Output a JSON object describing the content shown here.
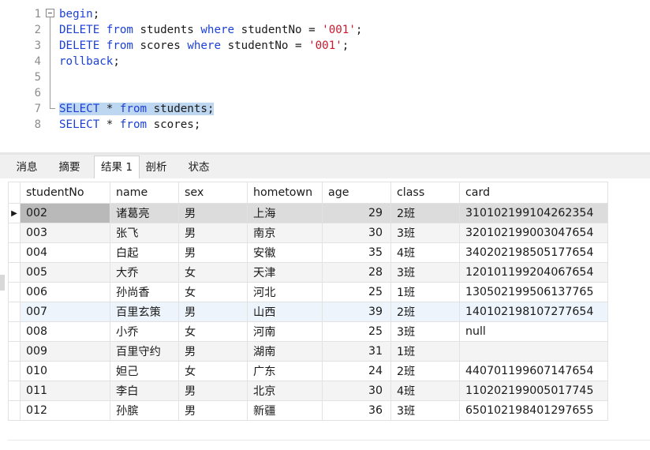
{
  "editor": {
    "line_numbers": [
      "1",
      "2",
      "3",
      "4",
      "5",
      "6",
      "7",
      "8"
    ],
    "lines": [
      [
        {
          "t": "begin",
          "c": "kw"
        },
        {
          "t": ";",
          "c": ""
        }
      ],
      [
        {
          "t": "DELETE",
          "c": "kw"
        },
        {
          "t": " ",
          "c": ""
        },
        {
          "t": "from",
          "c": "kw"
        },
        {
          "t": " students ",
          "c": ""
        },
        {
          "t": "where",
          "c": "kw"
        },
        {
          "t": " studentNo = ",
          "c": ""
        },
        {
          "t": "'001'",
          "c": "str"
        },
        {
          "t": ";",
          "c": ""
        }
      ],
      [
        {
          "t": "DELETE",
          "c": "kw"
        },
        {
          "t": " ",
          "c": ""
        },
        {
          "t": "from",
          "c": "kw"
        },
        {
          "t": " scores ",
          "c": ""
        },
        {
          "t": "where",
          "c": "kw"
        },
        {
          "t": " studentNo = ",
          "c": ""
        },
        {
          "t": "'001'",
          "c": "str"
        },
        {
          "t": ";",
          "c": ""
        }
      ],
      [
        {
          "t": "rollback",
          "c": "kw"
        },
        {
          "t": ";",
          "c": ""
        }
      ],
      [],
      [],
      [
        {
          "t": "SELECT",
          "c": "kw"
        },
        {
          "t": " * ",
          "c": ""
        },
        {
          "t": "from",
          "c": "kw"
        },
        {
          "t": " students;",
          "c": ""
        }
      ],
      [
        {
          "t": "SELECT",
          "c": "kw"
        },
        {
          "t": " * ",
          "c": ""
        },
        {
          "t": "from",
          "c": "kw"
        },
        {
          "t": " scores;",
          "c": ""
        }
      ]
    ],
    "selected_line_index": 6
  },
  "result_tabs": [
    {
      "label": "消息",
      "active": false
    },
    {
      "label": "摘要",
      "active": false
    },
    {
      "label": "结果 1",
      "active": true
    },
    {
      "label": "剖析",
      "active": false
    },
    {
      "label": "状态",
      "active": false
    }
  ],
  "grid": {
    "columns": [
      "studentNo",
      "name",
      "sex",
      "hometown",
      "age",
      "class",
      "card"
    ],
    "current_row_marker": "▶",
    "rows": [
      [
        "002",
        "诸葛亮",
        "男",
        "上海",
        "29",
        "2班",
        "310102199104262354"
      ],
      [
        "003",
        "张飞",
        "男",
        "南京",
        "30",
        "3班",
        "320102199003047654"
      ],
      [
        "004",
        "白起",
        "男",
        "安徽",
        "35",
        "4班",
        "340202198505177654"
      ],
      [
        "005",
        "大乔",
        "女",
        "天津",
        "28",
        "3班",
        "120101199204067654"
      ],
      [
        "006",
        "孙尚香",
        "女",
        "河北",
        "25",
        "1班",
        "130502199506137765"
      ],
      [
        "007",
        "百里玄策",
        "男",
        "山西",
        "39",
        "2班",
        "140102198107277654"
      ],
      [
        "008",
        "小乔",
        "女",
        "河南",
        "25",
        "3班",
        "null"
      ],
      [
        "009",
        "百里守约",
        "男",
        "湖南",
        "31",
        "1班",
        ""
      ],
      [
        "010",
        "妲己",
        "女",
        "广东",
        "24",
        "2班",
        "440701199607147654"
      ],
      [
        "011",
        "李白",
        "男",
        "北京",
        "30",
        "4班",
        "110202199005017745"
      ],
      [
        "012",
        "孙膑",
        "男",
        "新疆",
        "36",
        "3班",
        "650102198401297655"
      ]
    ],
    "current_row_index": 0,
    "highlighted_row_index": 5
  }
}
